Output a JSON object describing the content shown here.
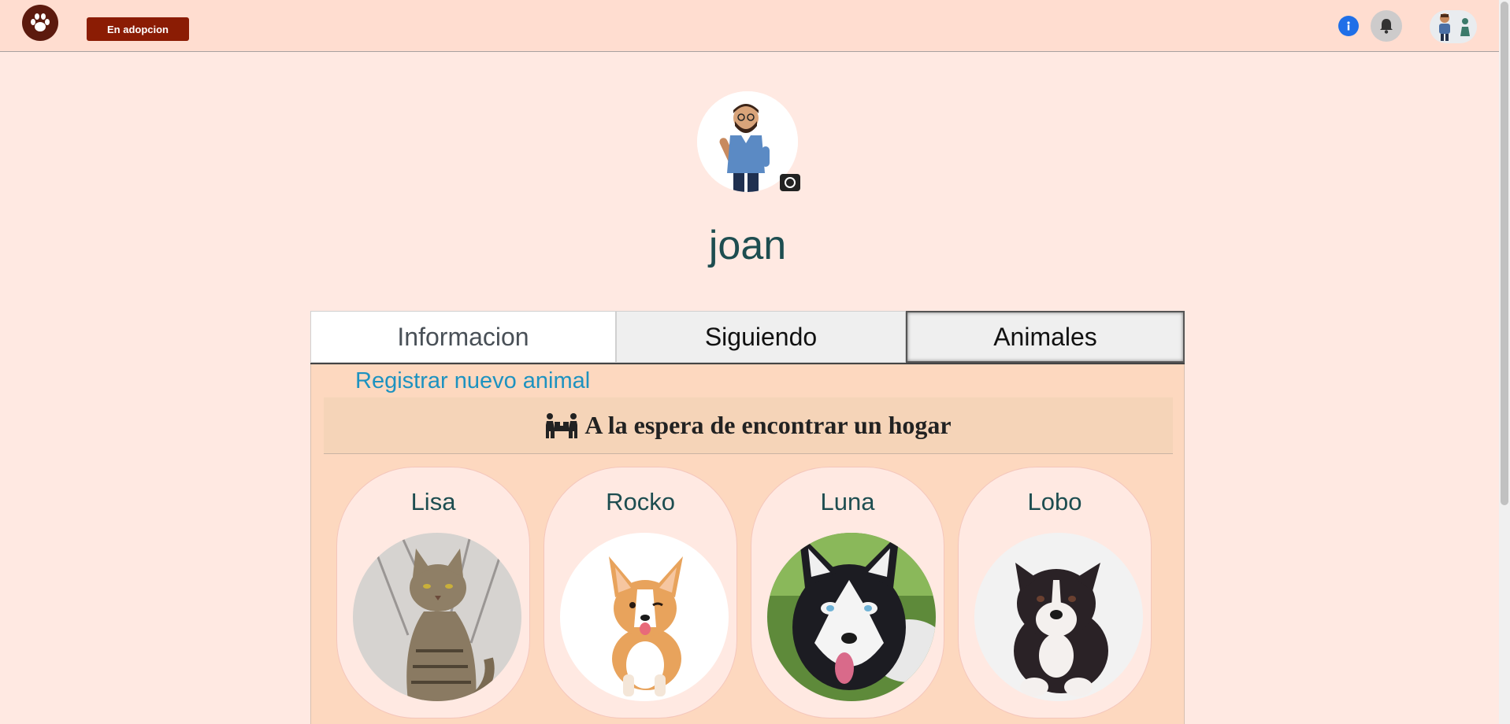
{
  "navbar": {
    "adopt_button": "En adopcion"
  },
  "profile": {
    "username": "joan"
  },
  "tabs": [
    {
      "label": "Informacion"
    },
    {
      "label": "Siguiendo"
    },
    {
      "label": "Animales"
    }
  ],
  "panel": {
    "register_link": "Registrar nuevo animal",
    "waiting_title": "A la espera de encontrar un hogar"
  },
  "animals": [
    {
      "name": "Lisa"
    },
    {
      "name": "Rocko"
    },
    {
      "name": "Luna"
    },
    {
      "name": "Lobo"
    }
  ],
  "icons": {
    "logo": "paw-icon",
    "info": "info-icon",
    "notifications": "bell-icon",
    "photo": "camera-icon",
    "waiting": "people-carrying-box-icon"
  },
  "colors": {
    "navbar_bg": "#ffddd0",
    "page_bg": "#ffe9e2",
    "adopt_button_bg": "#8b1c04",
    "username": "#1d4d50",
    "link": "#1d92c0",
    "panel_bg": "#fdd8bf"
  }
}
